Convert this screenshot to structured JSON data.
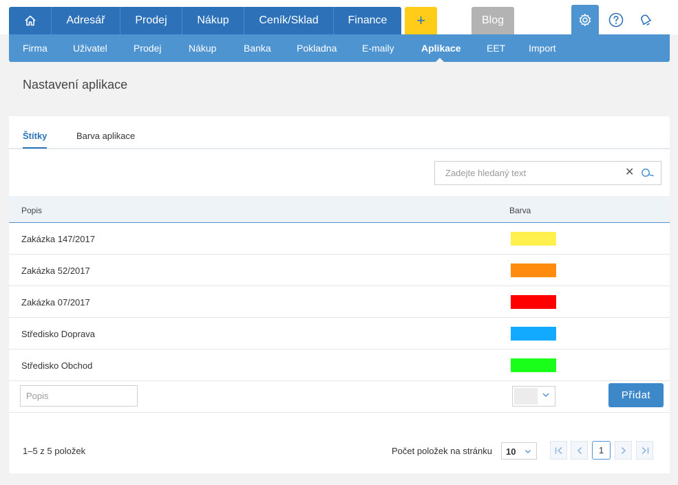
{
  "nav": {
    "main": [
      {
        "label": "Adresář"
      },
      {
        "label": "Prodej"
      },
      {
        "label": "Nákup"
      },
      {
        "label": "Ceník/Sklad"
      },
      {
        "label": "Finance"
      }
    ],
    "plus": "+",
    "blog": "Blog"
  },
  "subnav": {
    "items": [
      {
        "label": "Firma"
      },
      {
        "label": "Uživatel"
      },
      {
        "label": "Prodej"
      },
      {
        "label": "Nákup"
      },
      {
        "label": "Banka"
      },
      {
        "label": "Pokladna"
      },
      {
        "label": "E-maily"
      },
      {
        "label": "Aplikace"
      },
      {
        "label": "EET"
      },
      {
        "label": "Import"
      }
    ],
    "active": "Aplikace"
  },
  "page": {
    "title": "Nastavení aplikace"
  },
  "tabs": [
    {
      "label": "Štítky"
    },
    {
      "label": "Barva aplikace"
    }
  ],
  "search": {
    "placeholder": "Zadejte hledaný text",
    "value": ""
  },
  "table": {
    "columns": [
      "Popis",
      "Barva"
    ],
    "rows": [
      {
        "desc": "Zakázka 147/2017",
        "color": "#fff04d"
      },
      {
        "desc": "Zakázka 52/2017",
        "color": "#ff8c0f"
      },
      {
        "desc": "Zakázka 07/2017",
        "color": "#ff0000"
      },
      {
        "desc": "Středisko Doprava",
        "color": "#11aaff"
      },
      {
        "desc": "Středisko Obchod",
        "color": "#19ff19"
      }
    ]
  },
  "add_row": {
    "placeholder": "Popis",
    "button": "Přidat",
    "color": "#ececec"
  },
  "footer": {
    "count": "1–5 z 5 položek",
    "per_page_label": "Počet položek na stránku",
    "per_page": "10",
    "current_page": "1"
  },
  "colors": {
    "main_nav": "#2d72b9",
    "sub_nav": "#4d94d1",
    "plus": "#ffcc1a",
    "blog": "#b3b3b3",
    "button": "#3d88c9"
  }
}
